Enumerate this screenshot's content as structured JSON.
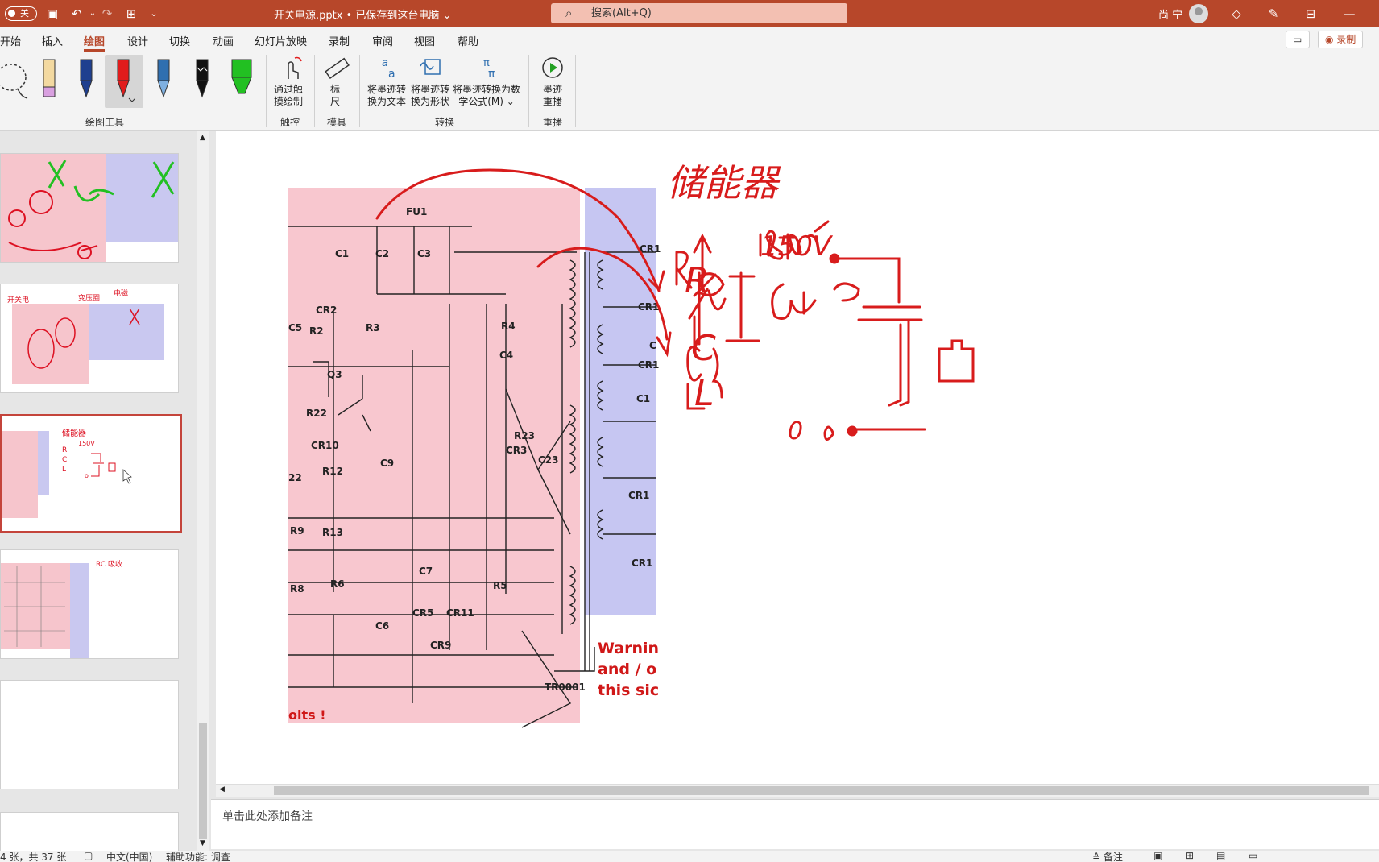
{
  "titlebar": {
    "autosave_label": "关",
    "document_title": "开关电源.pptx • 已保存到这台电脑 ⌄",
    "search_placeholder": "搜索(Alt+Q)",
    "user_name": "尚 宁",
    "minimize_glyph": "—"
  },
  "tabs": [
    "开始",
    "插入",
    "绘图",
    "设计",
    "切换",
    "动画",
    "幻灯片放映",
    "录制",
    "审阅",
    "视图",
    "帮助"
  ],
  "active_tab": "绘图",
  "tab_right": {
    "record_button": "◉ 录制"
  },
  "ribbon": {
    "groups": {
      "drawing_tools": "绘图工具",
      "touch": "触控",
      "stencils": "模具",
      "convert": "转换",
      "replay": "重播"
    },
    "buttons": {
      "touch_draw": "通过触\n摸绘制",
      "ruler": "标\n尺",
      "ink_to_text": "将墨迹转\n换为文本",
      "ink_to_shape": "将墨迹转\n换为形状",
      "ink_to_math": "将墨迹转换为数\n学公式(M) ⌄",
      "ink_replay": "墨迹\n重播"
    },
    "pen_colors": [
      "#f3d9a0",
      "#1f3f8f",
      "#e11c1c",
      "#2f6fb0",
      "#111111",
      "#22c022"
    ]
  },
  "slide": {
    "notes_placeholder": "单击此处添加备注",
    "circuit_labels": [
      "FU1",
      "C1",
      "C2",
      "C3",
      "CR2",
      "C5",
      "R2",
      "R3",
      "R4",
      "C4",
      "Q3",
      "R22",
      "CR10",
      "R12",
      "C9",
      "R23",
      "CR3",
      "C23",
      "22",
      "R9",
      "R13",
      "R8",
      "R6",
      "C7",
      "R5",
      "CR5",
      "CR11",
      "C6",
      "CR9",
      "TR0001",
      "CR1",
      "CR1",
      "CR1",
      "C",
      "C1",
      "CR1",
      "CR1"
    ],
    "warning_text": [
      "Warnin",
      "and / o",
      "this sic"
    ],
    "bottom_text": "olts !",
    "handwriting": {
      "title": "储能器",
      "voltage": "150V",
      "letters": [
        "R",
        "C",
        "L"
      ],
      "zero": "0"
    }
  },
  "statusbar": {
    "slide_count": "4 张，共 37 张",
    "language": "中文(中国)",
    "accessibility": "辅助功能: 调查",
    "notes_button": "≙ 备注"
  }
}
